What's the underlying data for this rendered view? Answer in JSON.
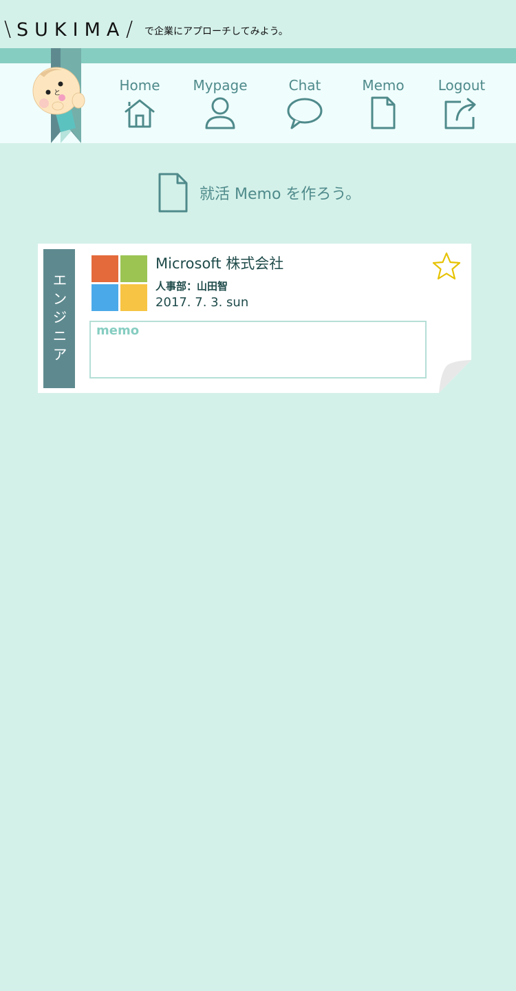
{
  "brand": {
    "slash_left": "\\",
    "name": "SUKIMA",
    "slash_right": "/",
    "tagline": "で企業にアプローチしてみよう。"
  },
  "nav": [
    {
      "label": "Home",
      "icon": "home-icon"
    },
    {
      "label": "Mypage",
      "icon": "user-icon"
    },
    {
      "label": "Chat",
      "icon": "chat-bubble-icon"
    },
    {
      "label": "Memo",
      "icon": "document-icon"
    },
    {
      "label": "Logout",
      "icon": "share-exit-icon"
    }
  ],
  "section": {
    "title": "就活 Memo を作ろう。",
    "icon": "document-icon"
  },
  "memo_card": {
    "category": "エンジニア",
    "company": "Microsoft 株式会社",
    "contact": "人事部：山田智",
    "date": "2017. 7. 3. sun",
    "memo_placeholder": "memo",
    "favorite_icon": "star-outline-icon"
  },
  "colors": {
    "background": "#d4f1e9",
    "header_bg": "#effdfc",
    "header_stripe": "#86cdc1",
    "accent": "#4f8a8b",
    "category_bg": "#5e8a8f",
    "star": "#e6c200",
    "logo_red": "#e46a3b",
    "logo_green": "#9bc452",
    "logo_blue": "#4aa9e9",
    "logo_yellow": "#f7c443"
  }
}
